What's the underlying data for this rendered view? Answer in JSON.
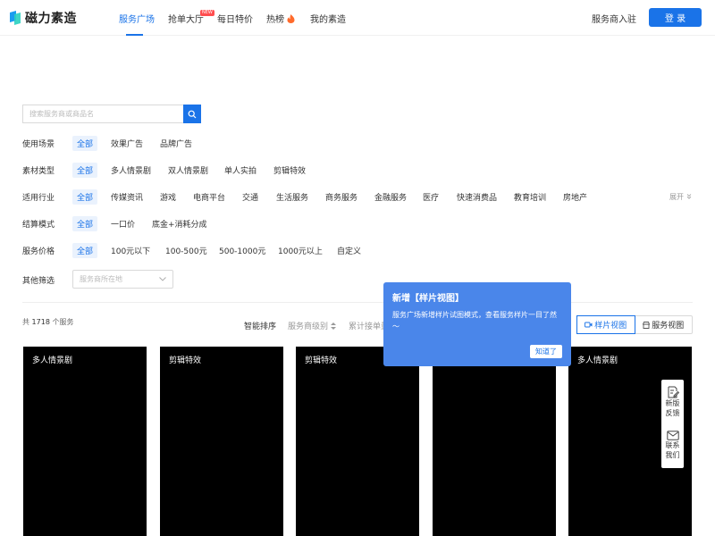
{
  "header": {
    "logo_text": "磁力素造",
    "nav": [
      {
        "label": "服务广场"
      },
      {
        "label": "抢单大厅",
        "badge": "NEW"
      },
      {
        "label": "每日特价"
      },
      {
        "label": "热榜"
      },
      {
        "label": "我的素造"
      }
    ],
    "merchant_link": "服务商入驻",
    "login": "登 录",
    "accent": "#1a73e8"
  },
  "search": {
    "placeholder": "搜索服务商或商品名"
  },
  "filters": {
    "scene": {
      "label": "使用场景",
      "options": [
        "全部",
        "效果广告",
        "品牌广告"
      ]
    },
    "material": {
      "label": "素材类型",
      "options": [
        "全部",
        "多人情景剧",
        "双人情景剧",
        "单人实拍",
        "剪辑特效"
      ]
    },
    "industry": {
      "label": "适用行业",
      "options": [
        "全部",
        "传媒资讯",
        "游戏",
        "电商平台",
        "交通",
        "生活服务",
        "商务服务",
        "金融服务",
        "医疗",
        "快速消费品",
        "教育培训",
        "房地产"
      ],
      "expand": "展开"
    },
    "settle": {
      "label": "结算模式",
      "options": [
        "全部",
        "一口价",
        "底金+消耗分成"
      ]
    },
    "price": {
      "label": "服务价格",
      "options": [
        "全部",
        "100元以下",
        "100-500元",
        "500-1000元",
        "1000元以上",
        "自定义"
      ]
    },
    "other": {
      "label": "其他筛选",
      "placeholder": "服务商所在地"
    }
  },
  "results": {
    "total_prefix": "共",
    "total_count": "1718",
    "total_suffix": "个服务",
    "sorts": [
      "智能排序",
      "服务商级别",
      "累计接单量"
    ],
    "view_sample": "样片视图",
    "view_service": "服务视图"
  },
  "cards": [
    {
      "label": "多人情景剧"
    },
    {
      "label": "剪辑特效"
    },
    {
      "label": "剪辑特效"
    },
    {
      "label": ""
    },
    {
      "label": "多人情景剧"
    }
  ],
  "popover": {
    "title": "新增【样片视图】",
    "body": "服务广场新增样片试图模式，查看服务样片一目了然～",
    "button": "知道了"
  },
  "sidebar": {
    "feedback": "新版反馈",
    "contact": "联系我们"
  }
}
